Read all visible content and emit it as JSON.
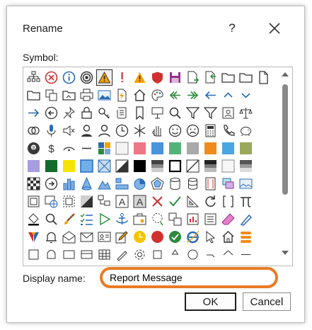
{
  "dialog": {
    "title": "Rename",
    "help_label": "?",
    "symbol_label": "Symbol:",
    "display_name_label": "Display name:",
    "display_name_value": "Report Message",
    "ok_label": "OK",
    "cancel_label": "Cancel",
    "accent_color": "#ea7b27"
  },
  "symbols": [
    "hierarchy-icon",
    "error-circle-icon",
    "info-circle-icon",
    "radio-target-icon",
    "warning-triangle-icon",
    "exclamation-icon",
    "warning-icon",
    "shield-red-icon",
    "save-icon",
    "document-export-icon",
    "document-import-icon",
    "folder-icon",
    "folder-open-icon",
    "document-icon",
    "folder-outline-icon",
    "copy-icon",
    "folder-share-icon",
    "printer-icon",
    "image-icon",
    "document-flash-icon",
    "home-icon",
    "palette-icon",
    "arrow-left-double-icon",
    "arrow-right-double-icon",
    "arrow-left-icon",
    "chevron-up-icon",
    "chevron-down-icon",
    "blank",
    "arrow-right-icon",
    "arrow-circle-left-icon",
    "pin-icon",
    "lock-icon",
    "key-icon",
    "scroll-icon",
    "bookmark-icon",
    "presentation-icon",
    "magnifier-icon",
    "filter-icon",
    "filter-alt-icon",
    "id-card-icon",
    "scales-icon",
    "blank",
    "link-rings-icon",
    "microphone-icon",
    "speaker-mute-icon",
    "person-silhouette-icon",
    "person-icon",
    "clock-icon",
    "snowflake-icon",
    "hand-icon",
    "smiley-icon",
    "sad-face-icon",
    "calculator-icon",
    "phone-icon",
    "piggy-bank-icon",
    "blank",
    "eight-ball-icon",
    "money-quote-icon",
    "eye-curve-icon",
    "dash-icon",
    "color-palette-grid-icon",
    "swatch-white-icon",
    "swatch-pink-icon",
    "swatch-blue-icon",
    "swatch-green-icon",
    "swatch-grey-icon",
    "swatch-orange-icon",
    "swatch-lightblue-icon",
    "swatch-olive-icon",
    "blank",
    "swatch-lavender-icon",
    "swatch-darkgreen-icon",
    "swatch-yellow-icon",
    "swatch-blue-border-icon",
    "swatch-pattern-icon",
    "swatch-diagonal-icon",
    "swatch-black-icon",
    "swatch-gradient-icon",
    "square-outline-icon",
    "diagonal-square-icon",
    "gradient-square-icon",
    "square-light-icon",
    "gradient-dark-icon",
    "blank",
    "checker-icon",
    "arrow-circle-right-icon",
    "bar-chart-icon",
    "cone-icon",
    "mountain-icon",
    "align-icon",
    "pie-chart-icon",
    "radar-chart-icon",
    "cylinder-icon",
    "database-icon",
    "film-strip-icon",
    "layers-icon",
    "picture-landscape-icon",
    "blank",
    "frame-icon",
    "globe-window-icon",
    "dotted-frame-icon",
    "shape-gradient-icon",
    "org-boxes-icon",
    "text-box-a-icon",
    "text-box-a-grey-icon",
    "red-x-icon",
    "green-check-icon",
    "ruler-square-icon",
    "refresh-icon",
    "brackets-icon",
    "pi-icon",
    "blank",
    "fill-bucket-icon",
    "search-icon",
    "paint-brush-icon",
    "checklist-icon",
    "play-outline-icon",
    "anchor-icon",
    "briefcase-icon",
    "lasso-icon",
    "stack-icon",
    "chart-document-icon",
    "list-box-icon",
    "eraser-icon",
    "pen-icon",
    "blank",
    "mosaic-logo-icon",
    "bell-icon",
    "envelope-open-icon",
    "envelope-icon",
    "contact-card-icon",
    "edit-icon",
    "yellow-clock-icon",
    "red-circle-icon",
    "green-check-circle-icon",
    "ie-icon",
    "pointer-icon",
    "house-outline-icon",
    "hamburger-icon",
    "blank",
    "box-icon",
    "bell-outline-icon",
    "letter-icon",
    "card-icon",
    "table-icon",
    "pencil-icon",
    "gear-icon",
    "stop-icon",
    "recycle-icon",
    "web-icon",
    "hand-point-icon",
    "house-icon",
    "line-icon",
    "blank"
  ]
}
